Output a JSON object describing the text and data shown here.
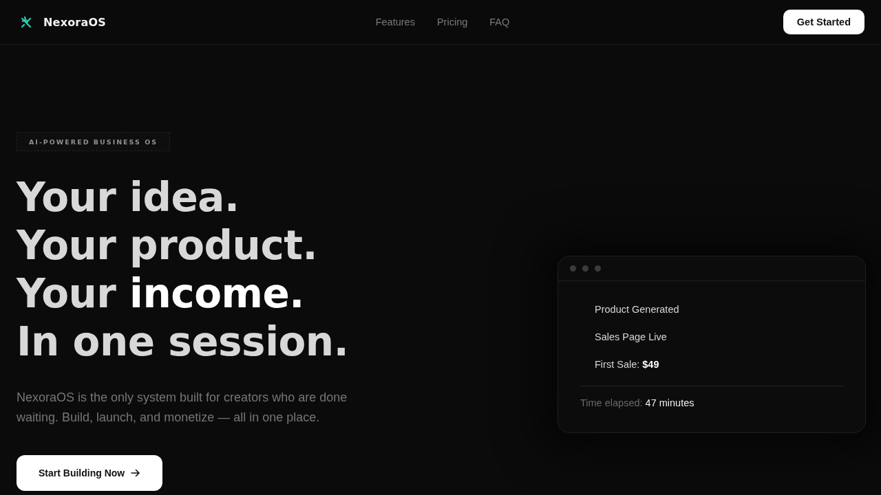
{
  "nav": {
    "brand": "NexoraOS",
    "links": [
      "Features",
      "Pricing",
      "FAQ"
    ],
    "cta": "Get Started"
  },
  "hero": {
    "badge": "AI-POWERED BUSINESS OS",
    "headline": [
      [
        {
          "text": "Your idea.",
          "bright": false
        }
      ],
      [
        {
          "text": "Your product.",
          "bright": false
        }
      ],
      [
        {
          "text": "Your ",
          "bright": false
        },
        {
          "text": "income.",
          "bright": true
        }
      ],
      [
        {
          "text": "In one session.",
          "bright": false
        }
      ]
    ],
    "description": "NexoraOS is the only system built for creators who are done waiting. Build, launch, and monetize — all in one place.",
    "cta": "Start Building Now"
  },
  "card": {
    "steps": [
      "Product Generated",
      "Sales Page Live",
      "First Sale: **$49**"
    ],
    "footer": {
      "label": "Time elapsed:",
      "value": "47 minutes"
    }
  }
}
